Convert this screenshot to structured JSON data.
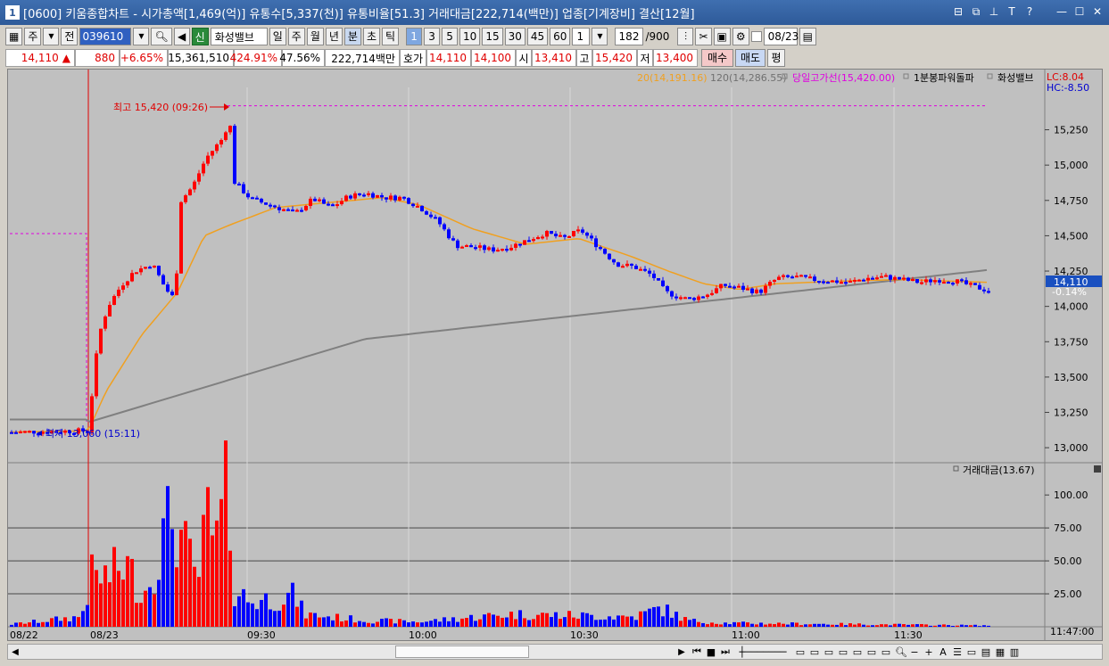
{
  "window": {
    "title": "[0600] 키움종합차트 - 시가총액[1,469(억)] 유통수[5,337(천)] 유통비율[51.3] 거래대금[222,714(백만)] 업종[기계장비] 결산[12월]",
    "app_icon": "1"
  },
  "toolbar": {
    "buttons_left": [
      "주",
      "전"
    ],
    "code": "039610",
    "stock_tag": "신",
    "stock_name": "화성밸브",
    "period_buttons": [
      "일",
      "주",
      "월",
      "년",
      "분",
      "초",
      "틱"
    ],
    "active_period": "분",
    "interval_buttons": [
      "1",
      "3",
      "5",
      "10",
      "15",
      "30",
      "45",
      "60"
    ],
    "active_interval": "1",
    "interval_select": "1",
    "count": "182",
    "count_max": "/900",
    "date": "08/23"
  },
  "quote": {
    "price": "14,110",
    "change_arrow": "▲",
    "change": "880",
    "change_pct": "+6.65%",
    "volume": "15,361,510",
    "volume_ratio": "424.91%",
    "turnover_pct": "47.56%",
    "amount": "222,714백만",
    "hoga_label": "호가",
    "ask": "14,110",
    "bid": "14,100",
    "open_label": "시",
    "open": "13,410",
    "high_label": "고",
    "high": "15,420",
    "low_label": "저",
    "low": "13,400",
    "buy_label": "매수",
    "sell_label": "매도",
    "avg_label": "평"
  },
  "chart_data": {
    "type": "candlestick",
    "legend": {
      "ma20": "20(14,191.16)",
      "ma120": "120(14,286.55)",
      "high_line": "당일고가선(15,420.00)",
      "indicator": "1분봉파워돌파",
      "name": "화성밸브"
    },
    "lc_label": "LC:8.04",
    "hc_label": "HC:-8.50",
    "high_annotation": "최고 15,420 (09:26)",
    "low_annotation": "최저 13,060 (15:11)",
    "current_price_tag": "14,110",
    "current_change_tag": "-0.14%",
    "price_ylim": [
      12900,
      15550
    ],
    "price_ticks": [
      "15,250",
      "15,000",
      "14,750",
      "14,500",
      "14,250",
      "14,000",
      "13,750",
      "13,500",
      "13,250",
      "13,000"
    ],
    "price_tick_values": [
      15250,
      15000,
      14750,
      14500,
      14250,
      14000,
      13750,
      13500,
      13250,
      13000
    ],
    "x_ticks": [
      "08/22",
      "08/23",
      "09:30",
      "10:00",
      "10:30",
      "11:00",
      "11:30",
      "11:47:00"
    ],
    "volume_title": "거래대금(13.67)",
    "volume_ticks": [
      "100.00",
      "75.00",
      "50.00",
      "25.00"
    ],
    "volume_tick_values": [
      100,
      75,
      50,
      25
    ],
    "volume_ylim": [
      0,
      115
    ],
    "colors": {
      "up": "#ff0000",
      "down": "#0000ff",
      "ma20": "#f0a020",
      "ma120": "#808080",
      "high_line": "#e000e0"
    }
  }
}
